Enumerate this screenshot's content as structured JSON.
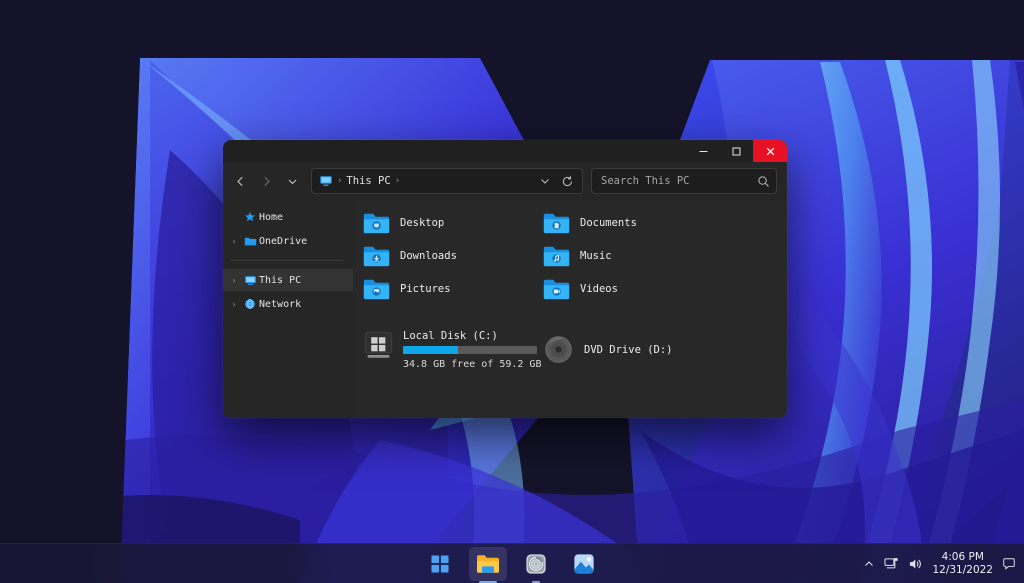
{
  "desktop": {
    "wallpaper_name": "windows-11-bloom-wallpaper",
    "background_color": "#15132a",
    "accent_blue": "#2f3ae0",
    "accent_light_blue": "#4fc3f7"
  },
  "window": {
    "app_name": "File Explorer",
    "titlebar": {
      "minimize_label": "–",
      "maximize_label": "❐",
      "close_label": "✕",
      "close_hover_color": "#e81123"
    },
    "toolbar": {
      "back_label": "‹",
      "forward_label": "›",
      "recent_label": "⌄",
      "refresh_label": "↻",
      "address_dropdown_label": "⌄"
    },
    "address": {
      "root_icon": "this-pc-icon",
      "crumb": "This PC",
      "separator": "›"
    },
    "search": {
      "placeholder": "Search This PC",
      "value": "",
      "icon": "search-icon"
    }
  },
  "sidebar": {
    "items": [
      {
        "label": "Home",
        "icon": "home-star-icon",
        "chevron": "",
        "selected": false
      },
      {
        "label": "OneDrive",
        "icon": "onedrive-folder-icon",
        "chevron": "›",
        "selected": false
      },
      {
        "label": "This PC",
        "icon": "this-pc-icon",
        "chevron": "›",
        "selected": true
      },
      {
        "label": "Network",
        "icon": "network-icon",
        "chevron": "›",
        "selected": false
      }
    ]
  },
  "content": {
    "folders": [
      {
        "label": "Desktop",
        "icon": "desktop-folder-icon"
      },
      {
        "label": "Documents",
        "icon": "documents-folder-icon"
      },
      {
        "label": "Downloads",
        "icon": "downloads-folder-icon"
      },
      {
        "label": "Music",
        "icon": "music-folder-icon"
      },
      {
        "label": "Pictures",
        "icon": "pictures-folder-icon"
      },
      {
        "label": "Videos",
        "icon": "videos-folder-icon"
      }
    ],
    "drives": {
      "local": {
        "label": "Local Disk (C:)",
        "free_text": "34.8 GB free of 59.2 GB",
        "used_percent": 41,
        "bar_color": "#0ea5e9",
        "icon": "hard-drive-icon"
      },
      "optical": {
        "label": "DVD Drive (D:)",
        "icon": "dvd-drive-icon"
      }
    }
  },
  "taskbar": {
    "items": [
      {
        "label": "Start",
        "icon": "windows-start-icon",
        "state": "idle"
      },
      {
        "label": "File Explorer",
        "icon": "file-explorer-icon",
        "state": "active"
      },
      {
        "label": "Settings",
        "icon": "settings-app-icon",
        "state": "open"
      },
      {
        "label": "Photos",
        "icon": "photos-app-icon",
        "state": "idle"
      }
    ],
    "tray": {
      "show_hidden_label": "˄",
      "network_icon": "network-tray-icon",
      "volume_icon": "volume-tray-icon",
      "time": "4:06 PM",
      "date": "12/31/2022",
      "notifications_icon": "notification-bell-icon"
    }
  }
}
